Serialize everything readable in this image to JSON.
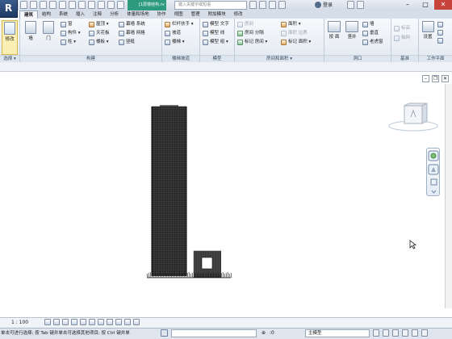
{
  "titlebar": {
    "app_letter": "R",
    "document_title": "[1层楼结构.rvt - 三维",
    "search_placeholder": "键入关键字或短语",
    "login_label": "登录",
    "window_min": "–",
    "window_max": "□",
    "window_close": "✕"
  },
  "tabs": [
    "建筑",
    "结构",
    "系统",
    "插入",
    "注释",
    "分析",
    "体量和场地",
    "协作",
    "视图",
    "管理",
    "附加模块",
    "修改"
  ],
  "active_tab": "建筑",
  "ribbon": {
    "select": {
      "modify_label": "修改",
      "panel_title": "选择 ▾"
    },
    "build": {
      "wall_label": "墙",
      "door_label": "门",
      "window_label": "窗",
      "component_label": "构件 ▾",
      "column_label": "柱 ▾",
      "roof_label": "屋顶 ▾",
      "ceiling_label": "天花板",
      "floor_label": "楼板 ▾",
      "curtain_system_label": "幕墙 系统",
      "curtain_grid_label": "幕墙 网格",
      "mullion_label": "竖梃",
      "panel_title": "构建"
    },
    "circulation": {
      "railing_label": "栏杆扶手 ▾",
      "ramp_label": "坡道",
      "stair_label": "楼梯 ▾",
      "panel_title": "楼梯坡道"
    },
    "model": {
      "model_text_label": "模型 文字",
      "model_line_label": "模型 线",
      "model_group_label": "模型 组 ▾",
      "panel_title": "模型"
    },
    "room_area": {
      "room_label": "房间",
      "room_separator_label": "房间 分隔",
      "tag_room_label": "标记 房间 ▾",
      "area_label": "面积 ▾",
      "area_boundary_label": "面积 边界",
      "tag_area_label": "标记 面积 ▾",
      "panel_title": "房间和面积 ▾"
    },
    "opening": {
      "by_face_label": "按 面",
      "shaft_label": "竖井",
      "wall_opening_label": "墙",
      "vertical_label": "垂直",
      "dormer_label": "老虎窗",
      "panel_title": "洞口"
    },
    "datum": {
      "level_label": "标高",
      "grid_label": "轴网",
      "panel_title": "基准"
    },
    "work_plane": {
      "set_label": "设置",
      "panel_title": "工作平面"
    }
  },
  "view_controls": {
    "minimize": "–",
    "restore": "❐",
    "close": "✕"
  },
  "status": {
    "scale_label": "1 : 100",
    "hint_text": "单击可进行选择; 按 Tab 键并单击可选择其他项目; 按 Ctrl 键并单",
    "workset_count": ":0",
    "model_selector": "主模型"
  }
}
